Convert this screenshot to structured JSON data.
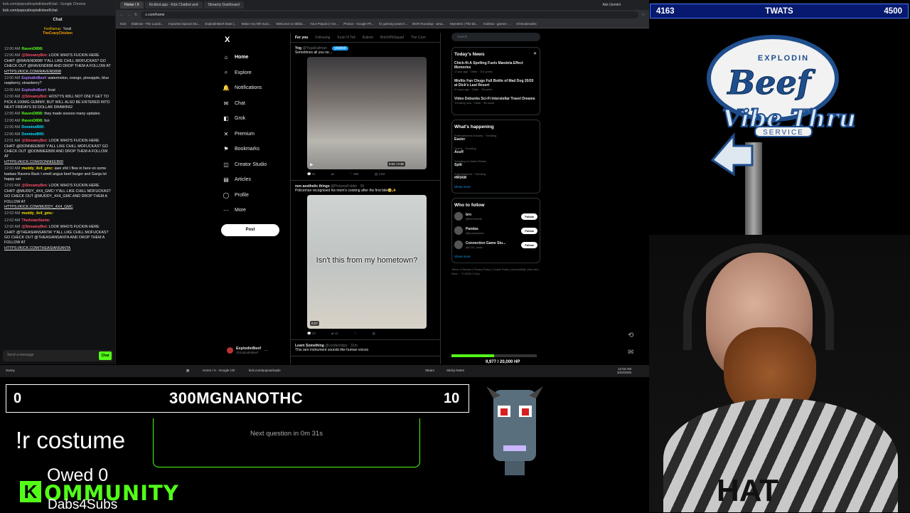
{
  "chat": {
    "tabbar_text": "kick.com/popout/explodinbeef/chat - Google Chrome",
    "url_text": "kick.com/popout/explodinbeef/chat",
    "header": "Chat",
    "pinned": {
      "user1": "Foolllamaz",
      "user2": "Tandi",
      "user3": "TheCrazyChicken"
    },
    "messages": [
      {
        "time": "12:00 AM",
        "user": "RavenD898:",
        "user_class": "u-green",
        "text": ""
      },
      {
        "time": "12:00 AM",
        "user": "@StreamyBot:",
        "user_class": "u-red",
        "text": "LOOK WHO'S FUCKIN HERE CHAT! @RAVEND898! Y'ALL LIKE CHILL MOFUCKAS? GO CHECK OUT @RAVEND898 AND DROP THEM A FOLLOW AT",
        "link": "HTTPS://KICK.COM/RAVEND898"
      },
      {
        "time": "12:00 AM",
        "user": "ExplodinBeef:",
        "user_class": "u-purple",
        "text": "watermelon, orange, pineapple, blue raspberry, strawberry?"
      },
      {
        "time": "12:00 AM",
        "user": "ExplodinBeef:",
        "user_class": "u-purple",
        "text": "frost"
      },
      {
        "time": "12:00 AM",
        "user": "@StreamyBot:",
        "user_class": "u-red",
        "text": "HOSTYS WILL NOT ONLY GET TO PICK A 100MG GUMMY, BUT WILL ALSO BE ENTERED INTO NEXT FRIDAYS 50 DOLLAR DRAWING!"
      },
      {
        "time": "12:00 AM",
        "user": "RavenD898:",
        "user_class": "u-green",
        "text": "they made sooooo many updates"
      },
      {
        "time": "12:00 AM",
        "user": "RavenD898:",
        "user_class": "u-green",
        "text": "fun"
      },
      {
        "time": "12:00 AM",
        "user": "DonnieeB00:",
        "user_class": "u-cyan",
        "text": ""
      },
      {
        "time": "12:00 AM",
        "user": "DonnieeB00:",
        "user_class": "u-cyan",
        "text": ""
      },
      {
        "time": "12:01 AM",
        "user": "@StreamyBot:",
        "user_class": "u-red",
        "text": "LOOK WHO'S FUCKIN HERE CHAT! @DONNIEEB00! Y'ALL LIKE CHILL MOFUCKAS? GO CHECK OUT @DONNIEEB00 AND DROP THEM A FOLLOW AT",
        "link": "HTTPS://KICK.COM/DONNIEEB00"
      },
      {
        "time": "12:02 AM",
        "user": "muddy_4x4_gmc:",
        "user_class": "u-yellow",
        "text": "awe shit I flew in here on some badass Ravens Back I smell angus beef burger and Ganja lol happy sat"
      },
      {
        "time": "12:02 AM",
        "user": "@StreamyBot:",
        "user_class": "u-red",
        "text": "LOOK WHO'S FUCKIN HERE CHAT! @MUDDY_4X4_GMC! Y'ALL LIKE CHILL MOFUCKAS? GO CHECK OUT @MUDDY_4X4_GMC AND DROP THEM A FOLLOW AT",
        "link": "HTTPS://KICK.COM/MUDDY_4X4_GMC"
      },
      {
        "time": "12:02 AM",
        "user": "muddy_4x4_gmc:",
        "user_class": "u-yellow",
        "text": ""
      },
      {
        "time": "12:02 AM",
        "user": "TheAsianSanta:",
        "user_class": "u-red",
        "text": ""
      },
      {
        "time": "12:02 AM",
        "user": "@StreamyBot:",
        "user_class": "u-red",
        "text": "LOOK WHO'S FUCKIN HERE CHAT! @THEASIANSANTA! Y'ALL LIKE CHILL MOFUCKAS? GO CHECK OUT @THEASIANSANTA AND DROP THEM A FOLLOW AT",
        "link": "HTTPS://KICK.COM/THEASIANSANTA"
      }
    ],
    "input_placeholder": "Send a message",
    "send_label": "Chat"
  },
  "browser": {
    "tabs": [
      "Home / X",
      "Kickbot.app - Kick Chatbot and",
      "Streamy Dashboard"
    ],
    "url": "x.com/home",
    "bookmarks": [
      "Kick",
      "Slakmat - The Loudo...",
      "Imported Spiced Stu...",
      "ExplodinBeef Stats |...",
      "Make Any Mfr Sour...",
      "Welcome to Obblo...",
      "Your Potpoloi | Ice...",
      "Photos - Google Ph...",
      "fiz gaming asset e...",
      "BGR Roundup - ama...",
      "Mymetric | The lat...",
      "Andreia - games -...",
      "All Bookmarks"
    ],
    "ask_gemini": "Ask Gemini"
  },
  "xnav": {
    "logo": "X",
    "items": [
      {
        "label": "Home",
        "icon": "⌂"
      },
      {
        "label": "Explore",
        "icon": "⌕"
      },
      {
        "label": "Notifications",
        "icon": "🔔"
      },
      {
        "label": "Chat",
        "icon": "✉"
      },
      {
        "label": "Grok",
        "icon": "◧"
      },
      {
        "label": "Premium",
        "icon": "✕"
      },
      {
        "label": "Bookmarks",
        "icon": "⚑"
      },
      {
        "label": "Creator Studio",
        "icon": "◫"
      },
      {
        "label": "Articles",
        "icon": "▤"
      },
      {
        "label": "Profile",
        "icon": "◯"
      },
      {
        "label": "More",
        "icon": "⋯"
      }
    ],
    "post_label": "Post",
    "account_name": "ExplodinBeef",
    "account_handle": "@ExplodinBeef"
  },
  "feed": {
    "tabs": [
      "For you",
      "Following",
      "Kush N Tell",
      "Autism",
      "BotchPitSquad",
      "The Com"
    ],
    "posts": [
      {
        "name": "Yog",
        "handle": "@YogaKaliman",
        "text": "Sometimes all you ne...",
        "duration": "0:04 / 0:35",
        "stats": [
          "51",
          "",
          "",
          "28K",
          "",
          "12M"
        ]
      },
      {
        "name": "non aesthetic things",
        "handle": "@PicturesFolder · 2h",
        "text": "Policeman recognised his mom's cooking after the first bite🥹✨",
        "caption": "Isn't this from my hometown?",
        "duration": "0:27",
        "stats": [
          "22",
          "",
          "11",
          "",
          "",
          ""
        ]
      },
      {
        "name": "Learn Something",
        "handle": "@cooltechtipz · 31m",
        "text": "This rare instrument sounds like human voices"
      }
    ],
    "posted_badge": "posted"
  },
  "right": {
    "search_placeholder": "Search",
    "todays_news_title": "Today's News",
    "news": [
      {
        "title": "Chick-fil-A Spelling Fuels Mandela Effect Memories",
        "meta": "1 hour ago · Other · 101 posts"
      },
      {
        "title": "Misfits Fan Chugs Full Bottle of Mad Dog 20/20 at Dick's Last Resort",
        "meta": "5 hours ago · Other · 98 posts"
      },
      {
        "title": "Video Debunks Sci-Fi Interstellar Travel Dreams",
        "meta": "Trending now · Other · 58 posts"
      }
    ],
    "whats_happening_title": "What's happening",
    "trends": [
      {
        "context": "Entertainment Industry · Trending",
        "name": "Easter"
      },
      {
        "context": "Sports · Trending",
        "name": "Acuff"
      },
      {
        "context": "Trending in United States",
        "name": "Split"
      },
      {
        "context": "Entertainment · Trending",
        "name": "#IRIAM"
      }
    ],
    "show_more": "Show more",
    "who_to_follow_title": "Who to follow",
    "follows": [
      {
        "name": "bro",
        "handle": "@BroTweets",
        "btn": "Follow"
      },
      {
        "name": "Pandas",
        "handle": "@buzzpandas",
        "btn": "Follow"
      },
      {
        "name": "Connection Game Stu...",
        "handle": "@CGS_India",
        "btn": "Follow"
      }
    ],
    "footer": "Terms of Service | Privacy Policy | Cookie Policy | Accessibility | Ads info | More ··· © 2025 X Corp."
  },
  "hp": {
    "text": "9,977 / 20,000 HP",
    "current": 9977,
    "max": 20000
  },
  "taskbar": {
    "weather": "Sunny",
    "time": "12:03 AM",
    "date": "3/22/2026",
    "apps": [
      "Home / X - Google Chr",
      "kick.com/popout/explo",
      "Steam",
      "Sticky Notes"
    ]
  },
  "versus": {
    "left_score": "4163",
    "right_label": "TWATS",
    "right_score": "4500"
  },
  "overlay": {
    "logo_top": "EXPLODIN",
    "logo_main": "Beef",
    "logo_sub": "Vibe Thru",
    "logo_service": "SERVICE",
    "bar_left": "0",
    "bar_word": "300MGNANOTHC",
    "bar_right": "10",
    "command": "!r costume",
    "next_question": "Next question in 0m 31s",
    "owed": "Owed 0",
    "kommunity": "OMMUNITY",
    "kick_letter": "K",
    "dabs": "Dabs4Subs",
    "shirt_text": "HAT"
  },
  "colors": {
    "kick_green": "#53fc18",
    "x_blue": "#1d9bf0",
    "versus_bg": "#06196f"
  }
}
